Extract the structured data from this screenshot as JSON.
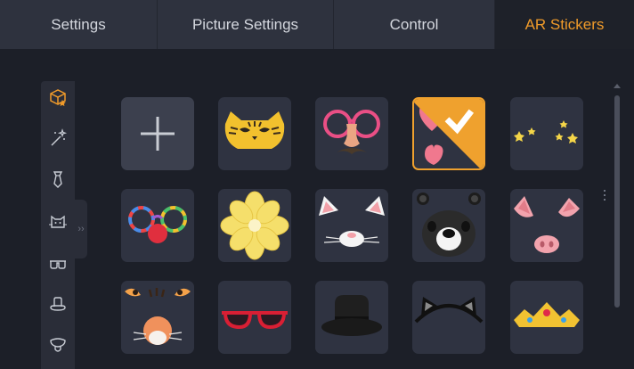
{
  "tabs": [
    {
      "label": "Settings",
      "active": false
    },
    {
      "label": "Picture Settings",
      "active": false
    },
    {
      "label": "Control",
      "active": false
    },
    {
      "label": "AR Stickers",
      "active": true
    }
  ],
  "colors": {
    "accent": "#ef9a2a",
    "panel": "#2f3341",
    "background": "#1c1f28"
  },
  "sidebar": {
    "categories": [
      {
        "icon": "sticker-box-icon",
        "active": true
      },
      {
        "icon": "magic-wand-icon",
        "active": false
      },
      {
        "icon": "necktie-icon",
        "active": false
      },
      {
        "icon": "cat-face-icon",
        "active": false
      },
      {
        "icon": "glasses-icon",
        "active": false
      },
      {
        "icon": "hat-icon",
        "active": false
      },
      {
        "icon": "tongue-face-icon",
        "active": false
      }
    ],
    "collapse_icon": "double-chevron-right-icon"
  },
  "stickers": [
    {
      "icon": "add-plus-icon",
      "selected": false
    },
    {
      "icon": "tiger-mask-icon",
      "selected": false
    },
    {
      "icon": "disguise-glasses-icon",
      "selected": false
    },
    {
      "icon": "hearts-icon",
      "selected": true
    },
    {
      "icon": "sparkle-stars-icon",
      "selected": false
    },
    {
      "icon": "clown-glasses-nose-icon",
      "selected": false
    },
    {
      "icon": "yellow-flower-icon",
      "selected": false
    },
    {
      "icon": "cat-ears-nose-icon",
      "selected": false
    },
    {
      "icon": "panda-face-icon",
      "selected": false
    },
    {
      "icon": "pig-ears-nose-icon",
      "selected": false
    },
    {
      "icon": "angry-face-icon",
      "selected": false
    },
    {
      "icon": "red-sunglasses-icon",
      "selected": false
    },
    {
      "icon": "black-fedora-icon",
      "selected": false
    },
    {
      "icon": "cat-ears-headband-icon",
      "selected": false
    },
    {
      "icon": "gold-crown-icon",
      "selected": false
    }
  ]
}
